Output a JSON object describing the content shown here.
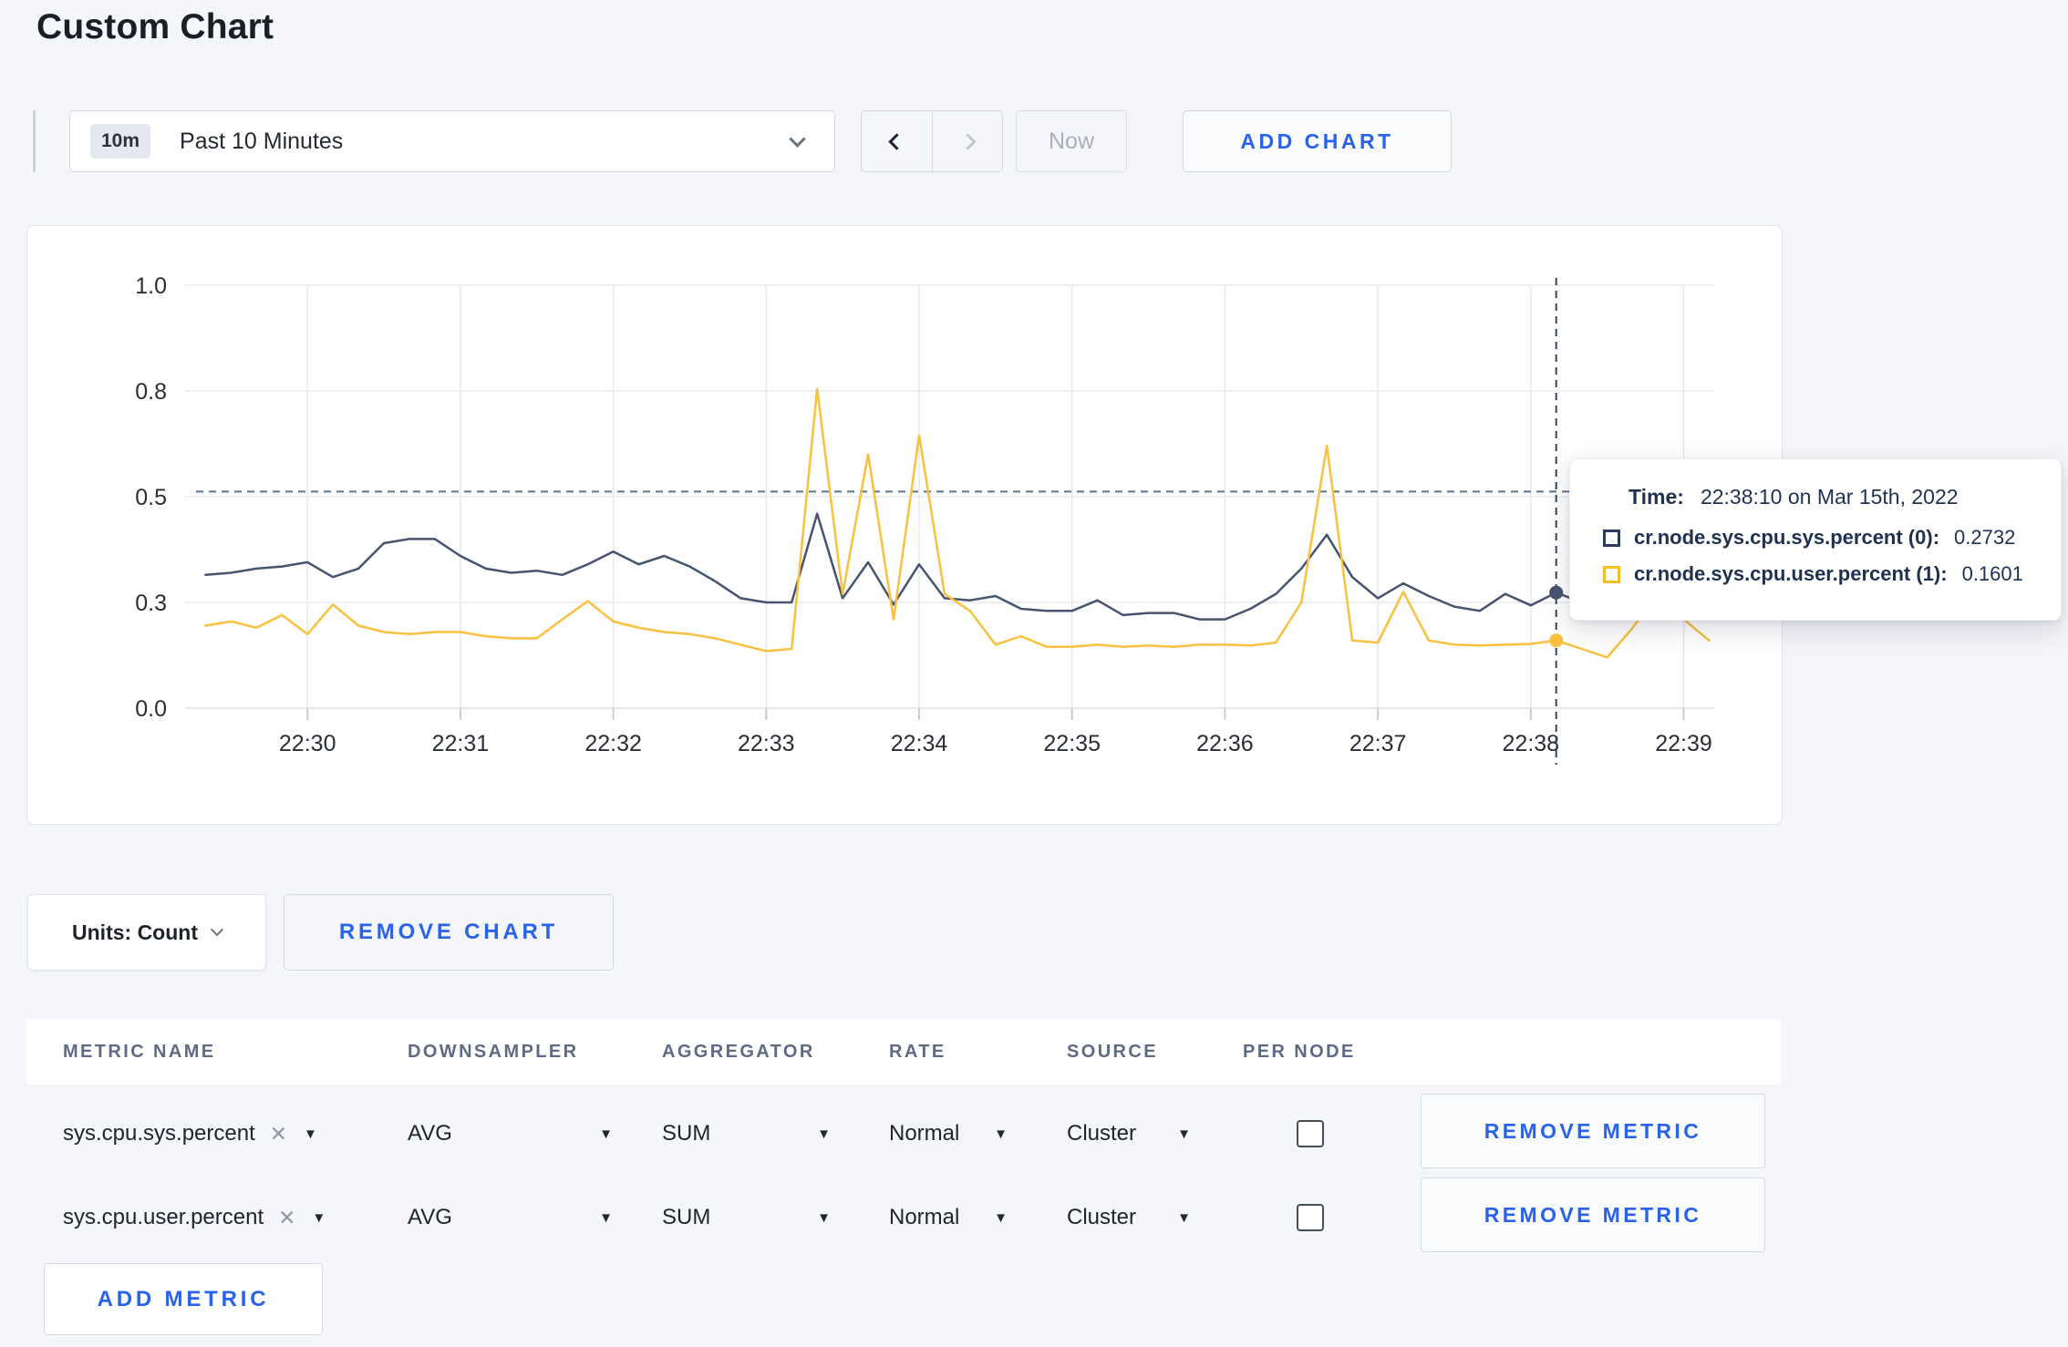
{
  "page": {
    "title": "Custom Chart"
  },
  "toolbar": {
    "range_badge": "10m",
    "range_label": "Past 10 Minutes",
    "now_label": "Now",
    "add_chart_label": "ADD CHART"
  },
  "chart_controls": {
    "units_label": "Units: Count",
    "remove_chart_label": "REMOVE CHART",
    "add_metric_label": "ADD METRIC"
  },
  "tooltip": {
    "time_label": "Time:",
    "time_value": "22:38:10 on Mar 15th, 2022",
    "series": [
      {
        "name": "cr.node.sys.cpu.sys.percent (0):",
        "value": "0.2732",
        "color": "#2d3c5c"
      },
      {
        "name": "cr.node.sys.cpu.user.percent (1):",
        "value": "0.1601",
        "color": "#f6bd28"
      }
    ]
  },
  "metrics_table": {
    "headers": [
      "METRIC NAME",
      "DOWNSAMPLER",
      "AGGREGATOR",
      "RATE",
      "SOURCE",
      "PER NODE"
    ],
    "remove_metric_label": "REMOVE METRIC",
    "remove_icon": "✕",
    "caret_icon": "▼",
    "rows": [
      {
        "metric": "sys.cpu.sys.percent",
        "downsampler": "AVG",
        "aggregator": "SUM",
        "rate": "Normal",
        "source": "Cluster",
        "per_node_checked": false
      },
      {
        "metric": "sys.cpu.user.percent",
        "downsampler": "AVG",
        "aggregator": "SUM",
        "rate": "Normal",
        "source": "Cluster",
        "per_node_checked": false
      }
    ]
  },
  "chart_data": {
    "type": "line",
    "title": "",
    "xlabel": "",
    "ylabel": "",
    "ylim": [
      0,
      1
    ],
    "grid": true,
    "legend_position": "tooltip",
    "x_ticks": [
      "22:30",
      "22:31",
      "22:32",
      "22:33",
      "22:34",
      "22:35",
      "22:36",
      "22:37",
      "22:38",
      "22:39"
    ],
    "y_ticks": {
      "values": [
        0,
        0.25,
        0.5,
        0.75,
        1.0
      ],
      "labels": [
        "0.0",
        "0.3",
        "0.5",
        "0.8",
        "1.0"
      ]
    },
    "x_domain_seconds": 600,
    "x_domain_start": "22:29:12",
    "tick_offset_seconds": 48,
    "sample_offset_seconds": 8,
    "sample_interval_seconds": 10,
    "hline": 0.512,
    "crosshair": {
      "t": 538,
      "time": "22:38:10",
      "values": {
        "sys": 0.2732,
        "user": 0.1601
      }
    },
    "series": [
      {
        "key": "sys",
        "name": "cr.node.sys.cpu.sys.percent",
        "color": "#46546f",
        "values": [
          0.315,
          0.32,
          0.33,
          0.335,
          0.345,
          0.31,
          0.33,
          0.39,
          0.4,
          0.4,
          0.36,
          0.33,
          0.32,
          0.325,
          0.315,
          0.34,
          0.37,
          0.34,
          0.36,
          0.335,
          0.3,
          0.26,
          0.25,
          0.25,
          0.46,
          0.26,
          0.345,
          0.245,
          0.34,
          0.26,
          0.255,
          0.265,
          0.235,
          0.23,
          0.23,
          0.255,
          0.22,
          0.225,
          0.225,
          0.21,
          0.21,
          0.235,
          0.27,
          0.33,
          0.41,
          0.31,
          0.26,
          0.295,
          0.265,
          0.24,
          0.23,
          0.27,
          0.243,
          0.2732,
          0.25,
          0.27,
          0.285,
          0.27,
          0.278,
          0.27
        ]
      },
      {
        "key": "user",
        "name": "cr.node.sys.cpu.user.percent",
        "color": "#f9c13d",
        "values": [
          0.195,
          0.205,
          0.19,
          0.22,
          0.175,
          0.245,
          0.195,
          0.18,
          0.175,
          0.18,
          0.18,
          0.17,
          0.165,
          0.165,
          0.21,
          0.253,
          0.205,
          0.19,
          0.18,
          0.175,
          0.165,
          0.15,
          0.135,
          0.14,
          0.755,
          0.27,
          0.6,
          0.21,
          0.645,
          0.27,
          0.23,
          0.15,
          0.17,
          0.145,
          0.145,
          0.15,
          0.145,
          0.148,
          0.145,
          0.15,
          0.15,
          0.148,
          0.155,
          0.25,
          0.62,
          0.16,
          0.155,
          0.275,
          0.16,
          0.15,
          0.148,
          0.15,
          0.152,
          0.1601,
          0.14,
          0.12,
          0.19,
          0.27,
          0.21,
          0.16
        ]
      }
    ]
  }
}
